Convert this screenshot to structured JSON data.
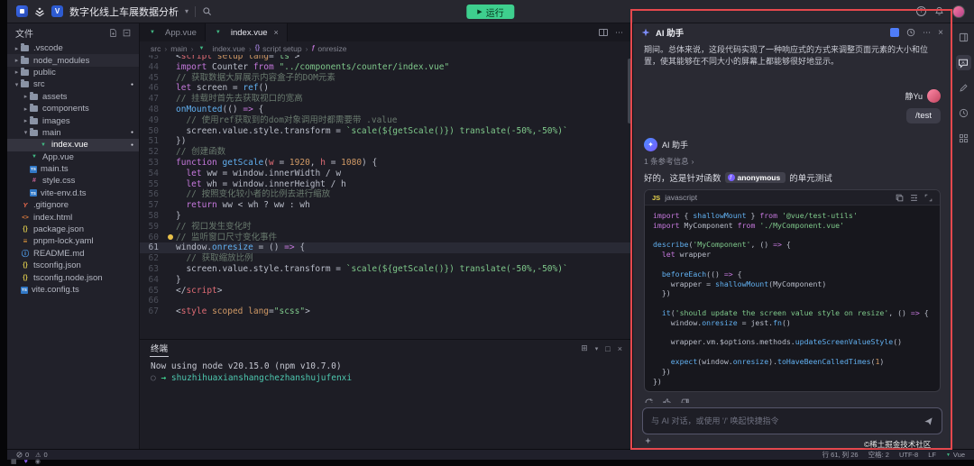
{
  "titlebar": {
    "project_title": "数字化线上车展数据分析",
    "run_label": "运行",
    "play_glyph": "▶"
  },
  "sidebar": {
    "header": "文件",
    "items": [
      {
        "label": ".vscode",
        "type": "folder",
        "depth": 0
      },
      {
        "label": "node_modules",
        "type": "folder",
        "depth": 0
      },
      {
        "label": "public",
        "type": "folder",
        "depth": 0
      },
      {
        "label": "src",
        "type": "folder-open",
        "depth": 0,
        "modified": true
      },
      {
        "label": "assets",
        "type": "folder",
        "depth": 1
      },
      {
        "label": "components",
        "type": "folder",
        "depth": 1
      },
      {
        "label": "images",
        "type": "folder",
        "depth": 1
      },
      {
        "label": "main",
        "type": "folder-open",
        "depth": 1,
        "modified": true
      },
      {
        "label": "index.vue",
        "type": "vue",
        "depth": 2,
        "active": true,
        "modified": true
      },
      {
        "label": "App.vue",
        "type": "vue",
        "depth": 1
      },
      {
        "label": "main.ts",
        "type": "ts",
        "depth": 1
      },
      {
        "label": "style.css",
        "type": "css",
        "depth": 1
      },
      {
        "label": "vite-env.d.ts",
        "type": "ts",
        "depth": 1
      },
      {
        "label": ".gitignore",
        "type": "git",
        "depth": 0
      },
      {
        "label": "index.html",
        "type": "html",
        "depth": 0
      },
      {
        "label": "package.json",
        "type": "json",
        "depth": 0
      },
      {
        "label": "pnpm-lock.yaml",
        "type": "yaml",
        "depth": 0
      },
      {
        "label": "README.md",
        "type": "md",
        "depth": 0
      },
      {
        "label": "tsconfig.json",
        "type": "json",
        "depth": 0
      },
      {
        "label": "tsconfig.node.json",
        "type": "json",
        "depth": 0
      },
      {
        "label": "vite.config.ts",
        "type": "ts",
        "depth": 0
      }
    ]
  },
  "tabs": [
    {
      "label": "App.vue",
      "active": false
    },
    {
      "label": "index.vue",
      "active": true
    }
  ],
  "breadcrumb": [
    {
      "label": "src"
    },
    {
      "label": "main"
    },
    {
      "label": "index.vue",
      "icon": "vue"
    },
    {
      "label": "script setup",
      "icon": "symbol"
    },
    {
      "label": "onresize",
      "icon": "event"
    }
  ],
  "editor": {
    "active_line": 61,
    "lines": [
      {
        "n": 43,
        "t": [
          [
            "pl",
            "<"
          ],
          [
            "tag",
            "script"
          ],
          [
            "pl",
            " "
          ],
          [
            "attr",
            "setup"
          ],
          [
            "pl",
            " "
          ],
          [
            "attr",
            "lang"
          ],
          [
            "pl",
            "="
          ],
          [
            "str",
            "\"ts\""
          ],
          [
            "pl",
            ">"
          ]
        ]
      },
      {
        "n": 44,
        "t": [
          [
            "kw",
            "import"
          ],
          [
            "pl",
            " Counter "
          ],
          [
            "kw",
            "from"
          ],
          [
            "pl",
            " "
          ],
          [
            "str",
            "\"../components/counter/index.vue\""
          ]
        ]
      },
      {
        "n": 45,
        "t": [
          [
            "cm",
            "// 获取数据大屏展示内容盒子的DOM元素"
          ]
        ]
      },
      {
        "n": 46,
        "t": [
          [
            "kw",
            "let"
          ],
          [
            "pl",
            " screen = "
          ],
          [
            "fn",
            "ref"
          ],
          [
            "pl",
            "()"
          ]
        ]
      },
      {
        "n": 47,
        "t": [
          [
            "cm",
            "// 挂载时首先去获取视口的宽高"
          ]
        ]
      },
      {
        "n": 48,
        "t": [
          [
            "fn",
            "onMounted"
          ],
          [
            "pl",
            "(() "
          ],
          [
            "kw",
            "=>"
          ],
          [
            "pl",
            " {"
          ]
        ]
      },
      {
        "n": 49,
        "t": [
          [
            "cm",
            "  // 使用ref获取到的dom对象调用时都需要带 .value"
          ]
        ]
      },
      {
        "n": 50,
        "t": [
          [
            "pl",
            "  screen.value.style.transform = "
          ],
          [
            "str",
            "`scale(${getScale()}) translate(-50%,-50%)`"
          ]
        ]
      },
      {
        "n": 51,
        "t": [
          [
            "pl",
            "})"
          ]
        ]
      },
      {
        "n": 52,
        "t": [
          [
            "cm",
            "// 创建函数"
          ]
        ]
      },
      {
        "n": 53,
        "t": [
          [
            "kw",
            "function"
          ],
          [
            "pl",
            " "
          ],
          [
            "fn",
            "getScale"
          ],
          [
            "pl",
            "("
          ],
          [
            "var",
            "w"
          ],
          [
            "pl",
            " = "
          ],
          [
            "num",
            "1920"
          ],
          [
            "pl",
            ", "
          ],
          [
            "var",
            "h"
          ],
          [
            "pl",
            " = "
          ],
          [
            "num",
            "1080"
          ],
          [
            "pl",
            ") {"
          ]
        ]
      },
      {
        "n": 54,
        "t": [
          [
            "pl",
            "  "
          ],
          [
            "kw",
            "let"
          ],
          [
            "pl",
            " ww = window.innerWidth / w"
          ]
        ]
      },
      {
        "n": 55,
        "t": [
          [
            "pl",
            "  "
          ],
          [
            "kw",
            "let"
          ],
          [
            "pl",
            " wh = window.innerHeight / h"
          ]
        ]
      },
      {
        "n": 56,
        "t": [
          [
            "cm",
            "  // 按照变化较小者的比例去进行缩放"
          ]
        ]
      },
      {
        "n": 57,
        "t": [
          [
            "pl",
            "  "
          ],
          [
            "kw",
            "return"
          ],
          [
            "pl",
            " ww < wh ? ww : wh"
          ]
        ]
      },
      {
        "n": 58,
        "t": [
          [
            "pl",
            "}"
          ]
        ]
      },
      {
        "n": 59,
        "t": [
          [
            "cm",
            "// 视口发生变化时"
          ]
        ]
      },
      {
        "n": 60,
        "bulb": true,
        "t": [
          [
            "cm",
            "// 监听窗口尺寸变化事件"
          ]
        ]
      },
      {
        "n": 61,
        "t": [
          [
            "pl",
            "window."
          ],
          [
            "fn",
            "onresize"
          ],
          [
            "pl",
            " = () "
          ],
          [
            "kw",
            "=>"
          ],
          [
            "pl",
            " {"
          ]
        ]
      },
      {
        "n": 62,
        "t": [
          [
            "cm",
            "  // 获取缩放比例"
          ]
        ]
      },
      {
        "n": 63,
        "t": [
          [
            "pl",
            "  screen.value.style.transform = "
          ],
          [
            "str",
            "`scale(${getScale()}) translate(-50%,-50%)`"
          ]
        ]
      },
      {
        "n": 64,
        "t": [
          [
            "pl",
            "}"
          ]
        ]
      },
      {
        "n": 65,
        "t": [
          [
            "pl",
            "</"
          ],
          [
            "tag",
            "script"
          ],
          [
            "pl",
            ">"
          ]
        ]
      },
      {
        "n": 66,
        "t": []
      },
      {
        "n": 67,
        "t": [
          [
            "pl",
            "<"
          ],
          [
            "tag",
            "style"
          ],
          [
            "pl",
            " "
          ],
          [
            "attr",
            "scoped"
          ],
          [
            "pl",
            " "
          ],
          [
            "attr",
            "lang"
          ],
          [
            "pl",
            "="
          ],
          [
            "str",
            "\"scss\""
          ],
          [
            "pl",
            ">"
          ]
        ]
      }
    ]
  },
  "terminal": {
    "tab": "终端",
    "node_line": "Now using node v20.15.0 (npm v10.7.0)",
    "prompt_path": "shuzhihuaxianshangchezhanshujufenxi"
  },
  "ai_panel": {
    "title": "AI 助手",
    "intro": "期间。总体来说，这段代码实现了一种响应式的方式来调整页面元素的大小和位置，使其能够在不同大小的屏幕上都能够很好地显示。",
    "user_name": "静Yu",
    "user_message": "/test",
    "assistant_name": "AI 助手",
    "reference_info": "1 条参考信息",
    "reference_chevron": "›",
    "reply_prefix": "好的，这是针对函数",
    "reply_badge": "anonymous",
    "reply_badge_glyph": "ƒ",
    "reply_suffix": "的单元测试",
    "code_lang_badge": "JS",
    "code_lang": "javascript",
    "code_lines": [
      {
        "t": [
          [
            "kw",
            "import"
          ],
          [
            "pl",
            " { "
          ],
          [
            "fn",
            "shallowMount"
          ],
          [
            "pl",
            " } "
          ],
          [
            "kw",
            "from"
          ],
          [
            "pl",
            " "
          ],
          [
            "str",
            "'@vue/test-utils'"
          ]
        ]
      },
      {
        "t": [
          [
            "kw",
            "import"
          ],
          [
            "pl",
            " MyComponent "
          ],
          [
            "kw",
            "from"
          ],
          [
            "pl",
            " "
          ],
          [
            "str",
            "'./MyComponent.vue'"
          ]
        ]
      },
      {
        "t": []
      },
      {
        "t": [
          [
            "fn",
            "describe"
          ],
          [
            "pl",
            "("
          ],
          [
            "str",
            "'MyComponent'"
          ],
          [
            "pl",
            ", () "
          ],
          [
            "kw",
            "=>"
          ],
          [
            "pl",
            " {"
          ]
        ]
      },
      {
        "t": [
          [
            "pl",
            "  "
          ],
          [
            "kw",
            "let"
          ],
          [
            "pl",
            " wrapper"
          ]
        ]
      },
      {
        "t": []
      },
      {
        "t": [
          [
            "pl",
            "  "
          ],
          [
            "fn",
            "beforeEach"
          ],
          [
            "pl",
            "(() "
          ],
          [
            "kw",
            "=>"
          ],
          [
            "pl",
            " {"
          ]
        ]
      },
      {
        "t": [
          [
            "pl",
            "    wrapper = "
          ],
          [
            "fn",
            "shallowMount"
          ],
          [
            "pl",
            "(MyComponent)"
          ]
        ]
      },
      {
        "t": [
          [
            "pl",
            "  })"
          ]
        ]
      },
      {
        "t": []
      },
      {
        "t": [
          [
            "pl",
            "  "
          ],
          [
            "fn",
            "it"
          ],
          [
            "pl",
            "("
          ],
          [
            "str",
            "'should update the screen value style on resize'"
          ],
          [
            "pl",
            ", () "
          ],
          [
            "kw",
            "=>"
          ],
          [
            "pl",
            " {"
          ]
        ]
      },
      {
        "t": [
          [
            "pl",
            "    window."
          ],
          [
            "fn",
            "onresize"
          ],
          [
            "pl",
            " = jest."
          ],
          [
            "fn",
            "fn"
          ],
          [
            "pl",
            "()"
          ]
        ]
      },
      {
        "t": []
      },
      {
        "t": [
          [
            "pl",
            "    wrapper.vm.$options.methods."
          ],
          [
            "fn",
            "updateScreenValueStyle"
          ],
          [
            "pl",
            "()"
          ]
        ]
      },
      {
        "t": []
      },
      {
        "t": [
          [
            "pl",
            "    "
          ],
          [
            "fn",
            "expect"
          ],
          [
            "pl",
            "(window."
          ],
          [
            "fn",
            "onresize"
          ],
          [
            "pl",
            ")."
          ],
          [
            "fn",
            "toHaveBeenCalledTimes"
          ],
          [
            "pl",
            "("
          ],
          [
            "num",
            "1"
          ],
          [
            "pl",
            ")"
          ]
        ]
      },
      {
        "t": [
          [
            "pl",
            "  })"
          ]
        ]
      },
      {
        "t": [
          [
            "pl",
            "})"
          ]
        ]
      }
    ],
    "input_placeholder": "与 AI 对话，或使用 '/' 唤起快捷指令"
  },
  "statusbar": {
    "errors": "0",
    "warnings": "0",
    "line_col": "行 61, 列 26",
    "indent": "空格: 2",
    "encoding": "UTF-8",
    "eol": "LF",
    "lang": "Vue"
  },
  "watermark": "©稀土掘金技术社区",
  "colors": {
    "accent_green": "#3ecf8e",
    "annotation_red": "#e5484d",
    "vue_green": "#41b883",
    "panel_bg": "#2a2a33"
  }
}
